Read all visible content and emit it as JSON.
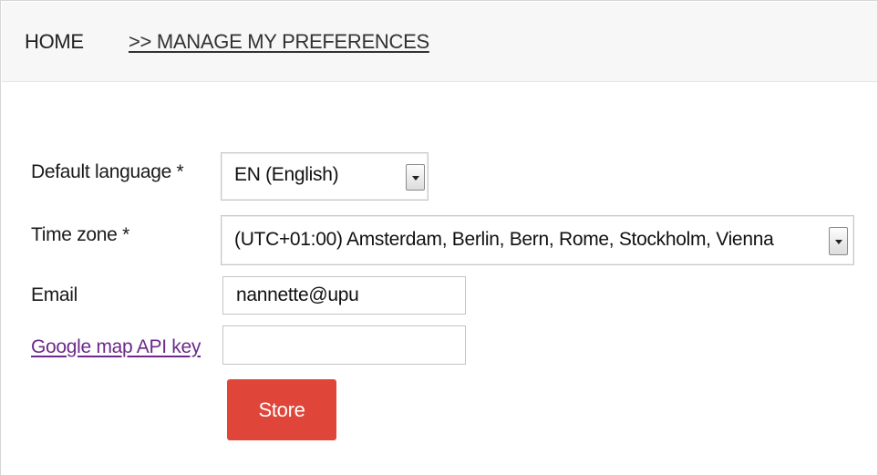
{
  "breadcrumb": {
    "home": "HOME",
    "current": ">> MANAGE MY PREFERENCES"
  },
  "form": {
    "language": {
      "label": "Default language *",
      "value": "EN (English)"
    },
    "timezone": {
      "label": "Time zone *",
      "value": "(UTC+01:00) Amsterdam, Berlin, Bern, Rome, Stockholm, Vienna"
    },
    "email": {
      "label": "Email",
      "value": "nannette@upu",
      "placeholder": ""
    },
    "google_api": {
      "label": "Google map API key",
      "value": "",
      "placeholder": ""
    },
    "store_label": "Store"
  },
  "colors": {
    "store_button": "#e0453a",
    "link": "#6b2a8a",
    "breadcrumb_bg": "#f7f7f7"
  }
}
